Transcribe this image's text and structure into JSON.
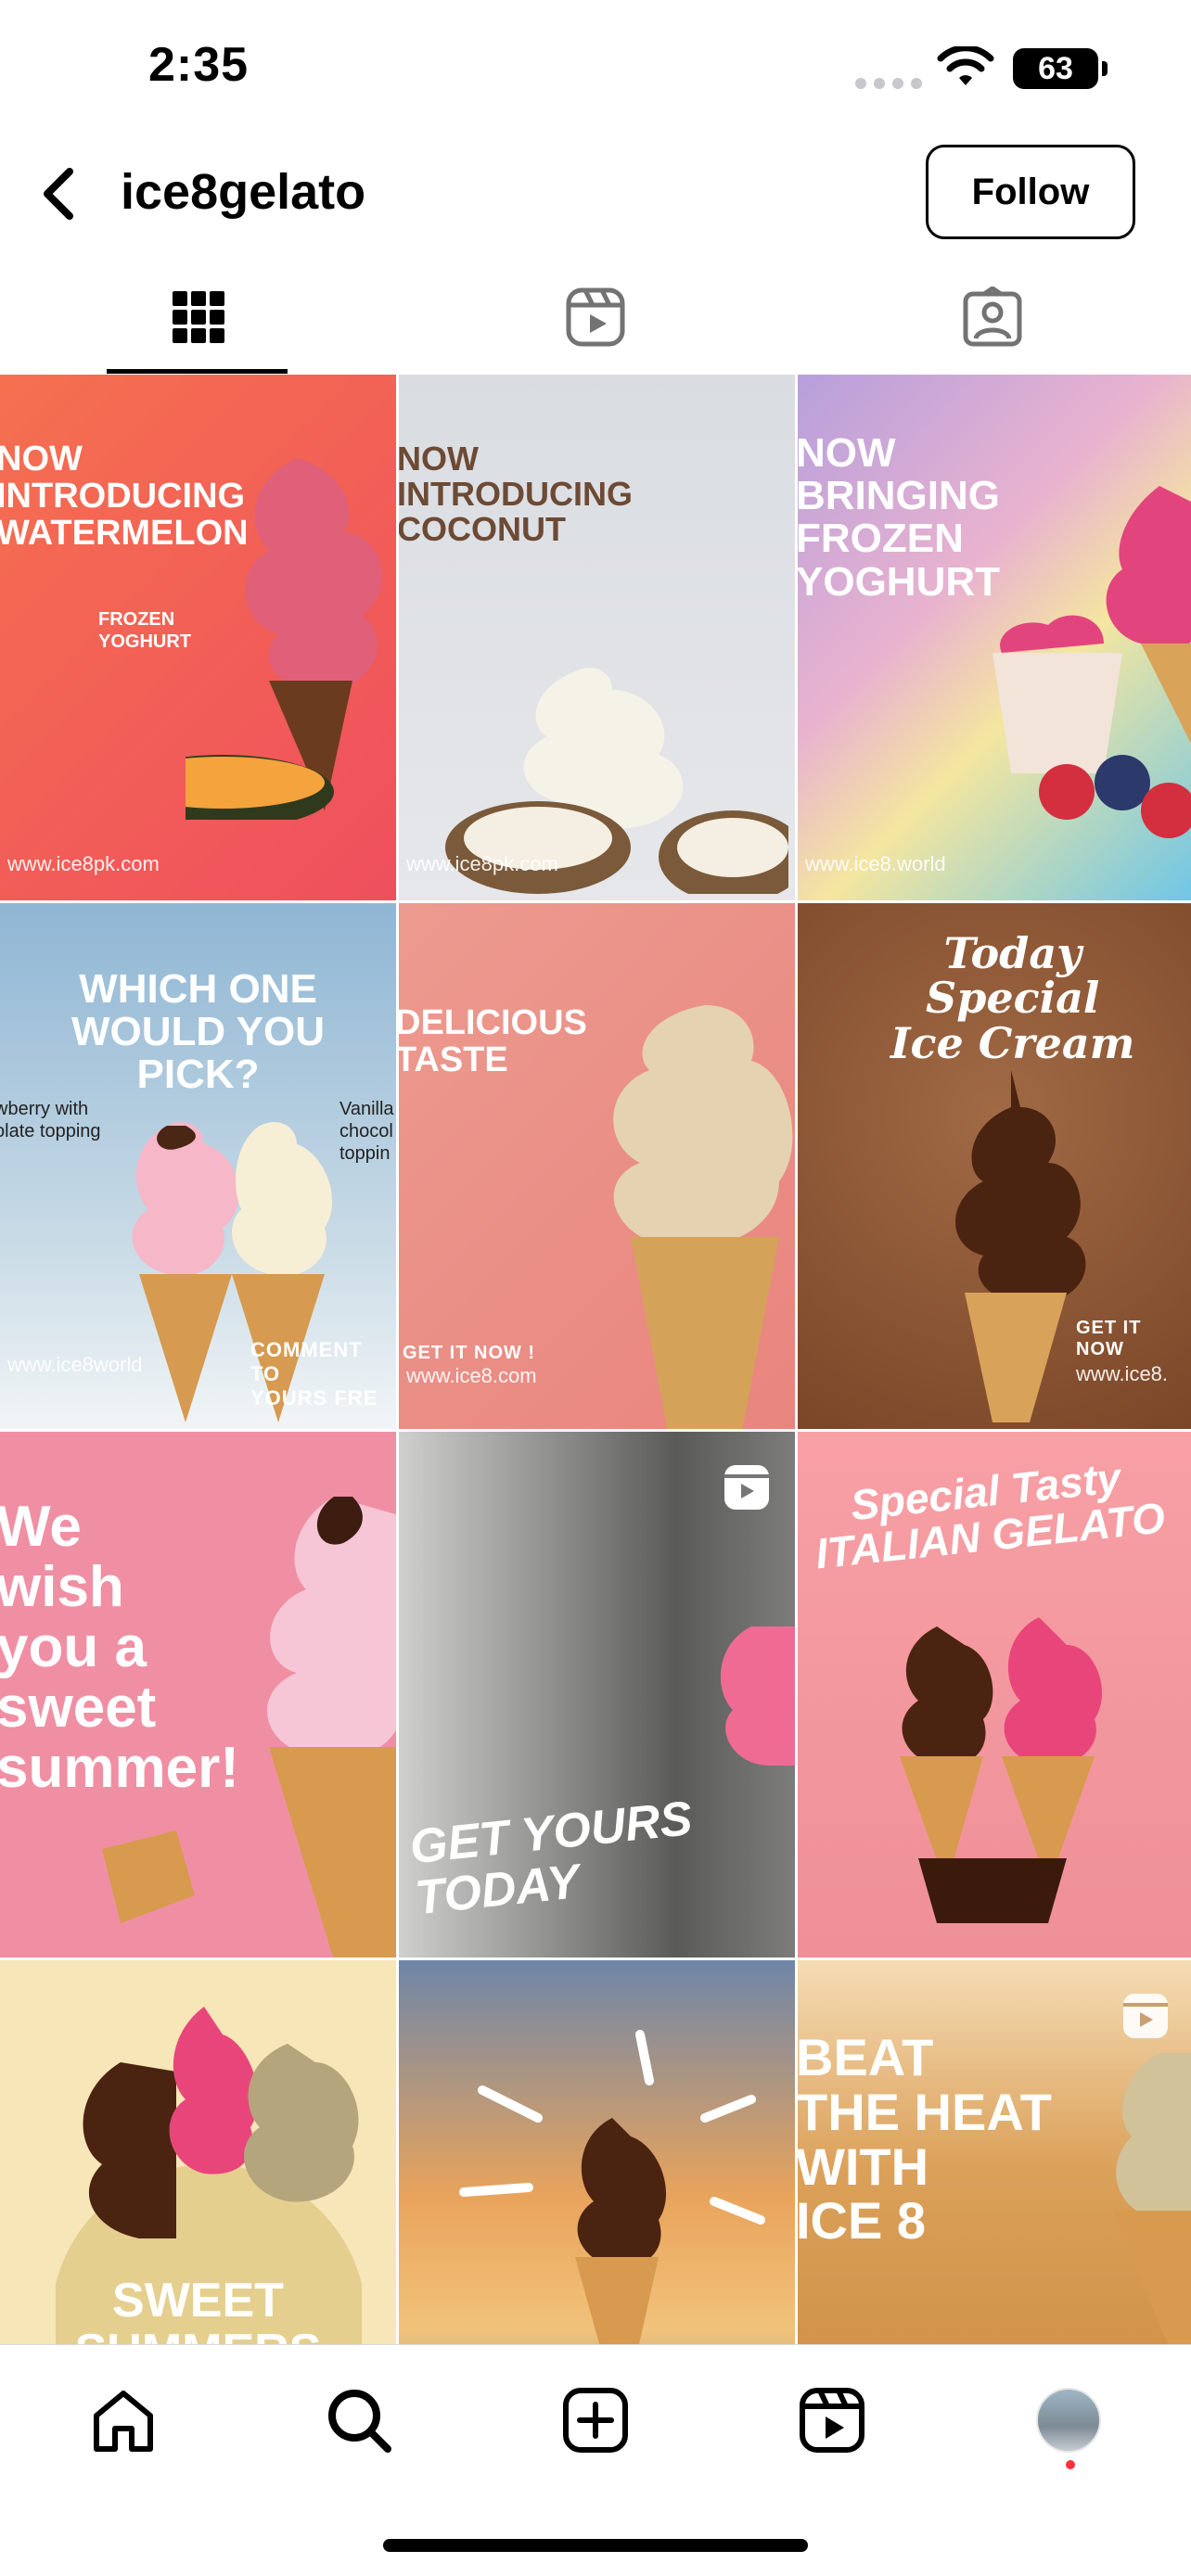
{
  "status_bar": {
    "time": "2:35",
    "battery": "63"
  },
  "header": {
    "username": "ice8gelato",
    "follow_label": "Follow"
  },
  "tabs": [
    {
      "icon": "grid-icon",
      "active": true
    },
    {
      "icon": "reels-icon",
      "active": false
    },
    {
      "icon": "tagged-icon",
      "active": false
    }
  ],
  "posts": [
    {
      "headline": "NOW\nINTRODUCING\nWATERMELON",
      "sub": "FROZEN\nYOGHURT",
      "watermark": "www.ice8pk.com",
      "bg": "#f2625a"
    },
    {
      "headline": "NOW\nINTRODUCING\nCOCONUT",
      "watermark": "www.ice8pk.com",
      "bg": "#d9dce0"
    },
    {
      "headline": "NOW\nBRINGING\nFROZEN\nYOGHURT",
      "watermark": "www.ice8.world",
      "bg": "#bda8dc"
    },
    {
      "headline": "WHICH ONE\nWOULD YOU\nPICK?",
      "left_label": "wberry with\nolate topping",
      "right_label": "Vanilla\nchocol\ntoppin",
      "watermark": "www.ice8world",
      "cta": "COMMENT TO\nYOURS FRE",
      "bg": "#a9c7dd"
    },
    {
      "headline": "DELICIOUS\nTASTE",
      "cta": "GET IT NOW !",
      "watermark": "www.ice8.com",
      "bg": "#e9918a"
    },
    {
      "headline": "Today\nSpecial\nIce Cream",
      "cta": "GET IT NOW",
      "watermark": "www.ice8.",
      "bg": "#8a5434"
    },
    {
      "headline": "We\nwish\nyou a\nsweet\nsummer!",
      "bg": "#f08fa3"
    },
    {
      "headline": "GET YOURS TODAY",
      "bg": "#9a9a98",
      "reel": true
    },
    {
      "headline": "Special Tasty\nITALIAN GELATO",
      "bg": "#f29aa0"
    },
    {
      "headline": "SWEET\nSUMMERS",
      "bg": "#f7e6b8"
    },
    {
      "headline": "",
      "bg": "#e9a45c"
    },
    {
      "headline": "BEAT\nTHE HEAT\nWITH\nICE 8",
      "bg": "#d79a4a",
      "reel": true
    }
  ],
  "bottom_nav": [
    {
      "icon": "home-icon"
    },
    {
      "icon": "search-icon"
    },
    {
      "icon": "create-icon"
    },
    {
      "icon": "reels-icon"
    },
    {
      "icon": "profile-avatar"
    }
  ]
}
